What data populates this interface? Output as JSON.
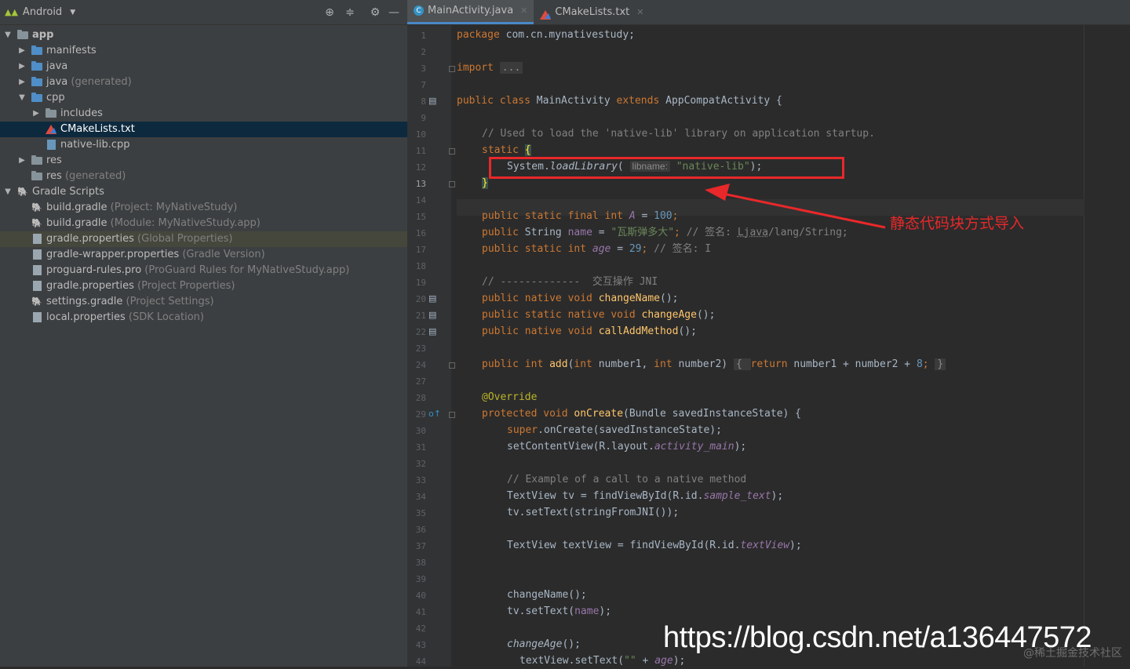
{
  "project": {
    "view_label": "Android",
    "rows": [
      {
        "label": "app",
        "hint": ""
      },
      {
        "label": "manifests",
        "hint": ""
      },
      {
        "label": "java",
        "hint": ""
      },
      {
        "label": "java",
        "hint": "(generated)"
      },
      {
        "label": "cpp",
        "hint": ""
      },
      {
        "label": "includes",
        "hint": ""
      },
      {
        "label": "CMakeLists.txt",
        "hint": ""
      },
      {
        "label": "native-lib.cpp",
        "hint": ""
      },
      {
        "label": "res",
        "hint": ""
      },
      {
        "label": "res",
        "hint": "(generated)"
      },
      {
        "label": "Gradle Scripts",
        "hint": ""
      },
      {
        "label": "build.gradle",
        "hint": "(Project: MyNativeStudy)"
      },
      {
        "label": "build.gradle",
        "hint": "(Module: MyNativeStudy.app)"
      },
      {
        "label": "gradle.properties",
        "hint": "(Global Properties)"
      },
      {
        "label": "gradle-wrapper.properties",
        "hint": "(Gradle Version)"
      },
      {
        "label": "proguard-rules.pro",
        "hint": "(ProGuard Rules for MyNativeStudy.app)"
      },
      {
        "label": "gradle.properties",
        "hint": "(Project Properties)"
      },
      {
        "label": "settings.gradle",
        "hint": "(Project Settings)"
      },
      {
        "label": "local.properties",
        "hint": "(SDK Location)"
      }
    ]
  },
  "tabs": [
    {
      "label": "MainActivity.java",
      "icon": "class-icon"
    },
    {
      "label": "CMakeLists.txt",
      "icon": "cmake-icon"
    }
  ],
  "editor": {
    "line_numbers": [
      "1",
      "2",
      "3",
      "7",
      "8",
      "9",
      "10",
      "11",
      "12",
      "13",
      "14",
      "15",
      "16",
      "17",
      "18",
      "19",
      "20",
      "21",
      "22",
      "23",
      "24",
      "27",
      "28",
      "29",
      "30",
      "31",
      "32",
      "33",
      "34",
      "35",
      "36",
      "37",
      "38",
      "39",
      "40",
      "41",
      "42",
      "43",
      "44"
    ],
    "current_line": "13"
  },
  "code": {
    "package_kw": "package",
    "package_name": " com.cn.mynativestudy;",
    "import_kw": "import",
    "import_fold": "...",
    "class_line": {
      "k1": "public class ",
      "name": "MainActivity",
      "k2": " extends ",
      "sup": "AppCompatActivity {"
    },
    "comment1": "// Used to load the 'native-lib' library on application startup.",
    "static_kw": "static ",
    "static_brace": "{",
    "load_pre": "System.",
    "load_fn": "loadLibrary",
    "load_paren": "( ",
    "load_hint": "libname:",
    "load_str": "\"native-lib\"",
    "load_end": ");",
    "close_brace": "}",
    "field_a": {
      "kw": "public static final int ",
      "name": "A",
      "eq": " = ",
      "val": "100",
      "end": ";"
    },
    "field_name": {
      "kw": "public ",
      "type": "String ",
      "name": "name",
      "eq": " = ",
      "val": "\"瓦斯弹多大\"",
      "end": "; ",
      "cm": "// 签名: ",
      "sig": "Ljava",
      "rest": "/lang/String;"
    },
    "field_age": {
      "kw": "public static int ",
      "name": "age",
      "eq": " = ",
      "val": "29",
      "end": "; ",
      "cm": "// 签名: I"
    },
    "comment2": "// -------------  交互操作 JNI",
    "m1": {
      "kw": "public native void ",
      "name": "changeName",
      "end": "();"
    },
    "m2": {
      "kw": "public static native void ",
      "name": "changeAge",
      "end": "();"
    },
    "m3": {
      "kw": "public native void ",
      "name": "callAddMethod",
      "end": "();"
    },
    "add": {
      "k1": "public int ",
      "name": "add",
      "p1": "(",
      "t1": "int ",
      "a1": "number1, ",
      "t2": "int ",
      "a2": "number2) ",
      "b1": "{ ",
      "rk": "return ",
      "expr": "number1 + number2 + ",
      "n": "8",
      "sc": "; ",
      "b2": "}"
    },
    "override": "@Override",
    "oncreate": {
      "kw": "protected void ",
      "name": "onCreate",
      "rest": "(Bundle savedInstanceState) {"
    },
    "super": {
      "kw": "super",
      "rest": ".onCreate(savedInstanceState);"
    },
    "setcv": {
      "pre": "setContentView(R.layout.",
      "f": "activity_main",
      "end": ");"
    },
    "comment3": "// Example of a call to a native method",
    "tv1": {
      "pre": "TextView tv = findViewById(R.id.",
      "f": "sample_text",
      "end": ");"
    },
    "tv2": "tv.setText(stringFromJNI());",
    "tv3": {
      "pre": "TextView textView = findViewById(R.id.",
      "f": "textView",
      "end": ");"
    },
    "cn": "changeName();",
    "setname": {
      "pre": "tv.setText(",
      "f": "name",
      "end": ");"
    },
    "ca": {
      "f": "changeAge",
      "end": "();"
    },
    "setage": {
      "pre": "textView.setText(",
      "s": "\"\"",
      "mid": " + ",
      "f": "age",
      "end": ");"
    }
  },
  "annotation_text": "静态代码块方式导入",
  "watermark": "https://blog.csdn.net/a136447572",
  "watermark2": "@稀土掘金技术社区"
}
